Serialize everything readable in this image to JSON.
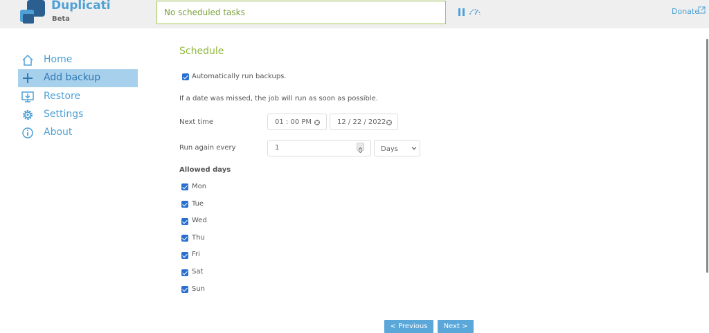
{
  "header": {
    "brand": "Duplicati",
    "badge": "Beta",
    "status": "No scheduled tasks",
    "donate": "Donate",
    "colors": {
      "accent": "#4ea0d6",
      "status_border": "#a3c54b",
      "status_text": "#7aa03a"
    }
  },
  "sidebar": {
    "items": [
      {
        "label": "Home",
        "icon": "home-icon"
      },
      {
        "label": "Add backup",
        "icon": "plus-icon",
        "active": true
      },
      {
        "label": "Restore",
        "icon": "restore-icon"
      },
      {
        "label": "Settings",
        "icon": "gear-icon"
      },
      {
        "label": "About",
        "icon": "info-icon"
      }
    ]
  },
  "schedule": {
    "title": "Schedule",
    "auto_run_label": "Automatically run backups.",
    "auto_run_checked": true,
    "missed_note": "If a date was missed, the job will run as soon as possible.",
    "next_time_label": "Next time",
    "time_value": "01 : 00   PM",
    "date_value": "12 / 22 / 2022",
    "run_again_label": "Run again every",
    "run_again_value": "1",
    "unit_selected": "Days",
    "allowed_days_label": "Allowed days",
    "days": [
      {
        "label": "Mon",
        "checked": true
      },
      {
        "label": "Tue",
        "checked": true
      },
      {
        "label": "Wed",
        "checked": true
      },
      {
        "label": "Thu",
        "checked": true
      },
      {
        "label": "Fri",
        "checked": true
      },
      {
        "label": "Sat",
        "checked": true
      },
      {
        "label": "Sun",
        "checked": true
      }
    ]
  },
  "nav_buttons": {
    "previous": "< Previous",
    "next": "Next >"
  }
}
